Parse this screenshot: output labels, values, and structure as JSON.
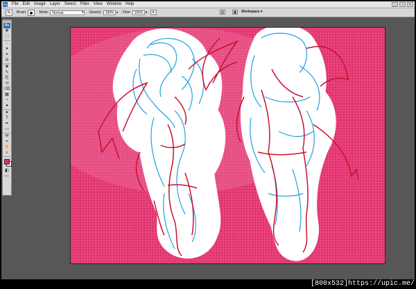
{
  "menubar": {
    "items": [
      "File",
      "Edit",
      "Image",
      "Layer",
      "Select",
      "Filter",
      "View",
      "Window",
      "Help"
    ],
    "window_controls": [
      "_",
      "▫",
      "×"
    ]
  },
  "options": {
    "brush_label": "Brush:",
    "mode_label": "Mode:",
    "mode_value": "Normal",
    "opacity_label": "Opacity:",
    "opacity_value": "100%",
    "flow_label": "Flow:",
    "flow_value": "100%",
    "workspace_label": "Workspace ▾"
  },
  "tools": {
    "badge": "Ps",
    "items": [
      "move-tool",
      "marquee-tool",
      "lasso-tool",
      "magic-wand-tool",
      "crop-tool",
      "slice-tool",
      "healing-brush-tool",
      "brush-tool",
      "clone-stamp-tool",
      "history-brush-tool",
      "eraser-tool",
      "gradient-tool",
      "blur-tool",
      "dodge-tool",
      "path-selection-tool",
      "type-tool",
      "pen-tool",
      "shape-tool",
      "notes-tool",
      "eyedropper-tool",
      "hand-tool",
      "zoom-tool"
    ],
    "glyphs": [
      "✥",
      "⬚",
      "◌",
      "✦",
      "⌗",
      "⧄",
      "✚",
      "✎",
      "⎘",
      "⟲",
      "⌫",
      "▦",
      "◔",
      "●",
      "➤",
      "T",
      "✒",
      "▭",
      "✉",
      "⌖",
      "✋",
      "⌕"
    ],
    "foreground_color": "#e0306e",
    "background_color": "#ffffff",
    "mode_icons": [
      "quick-mask-icon",
      "screen-mode-icon"
    ]
  },
  "canvas": {
    "background_color": "#e8407c",
    "line_color_red": "#c8102e",
    "line_color_blue": "#1ea0e0",
    "description_icon": "sketch-artwork"
  },
  "watermark": {
    "text": "[800x532]https://upic.me/"
  }
}
